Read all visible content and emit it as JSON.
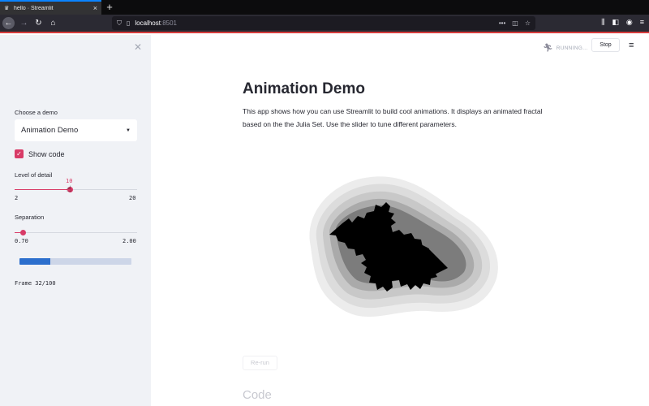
{
  "browser": {
    "tab_title": "hello · Streamlit",
    "tab_favicon": "streamlit-crown-icon",
    "url_host": "localhost",
    "url_port": ":8501"
  },
  "sidebar": {
    "choose_demo_label": "Choose a demo",
    "selected_demo": "Animation Demo",
    "show_code_label": "Show code",
    "show_code_checked": true,
    "level_label": "Level of detail",
    "level_value": "10",
    "level_min": "2",
    "level_max": "20",
    "separation_label": "Separation",
    "separation_value": 0.7,
    "separation_min": "0.70",
    "separation_max": "2.00",
    "progress": 0.32,
    "frame_text": "Frame 32/100"
  },
  "header": {
    "status_text": "RUNNING...",
    "stop_label": "Stop"
  },
  "main": {
    "title": "Animation Demo",
    "description": "This app shows how you can use Streamlit to build cool animations. It displays an animated fractal based on the the Julia Set. Use the slider to tune different parameters.",
    "rerun_label": "Re-run",
    "code_heading": "Code"
  },
  "colors": {
    "accent": "#d83b67",
    "progress": "#2c6fcd",
    "sidebar_bg": "#f0f2f6"
  }
}
